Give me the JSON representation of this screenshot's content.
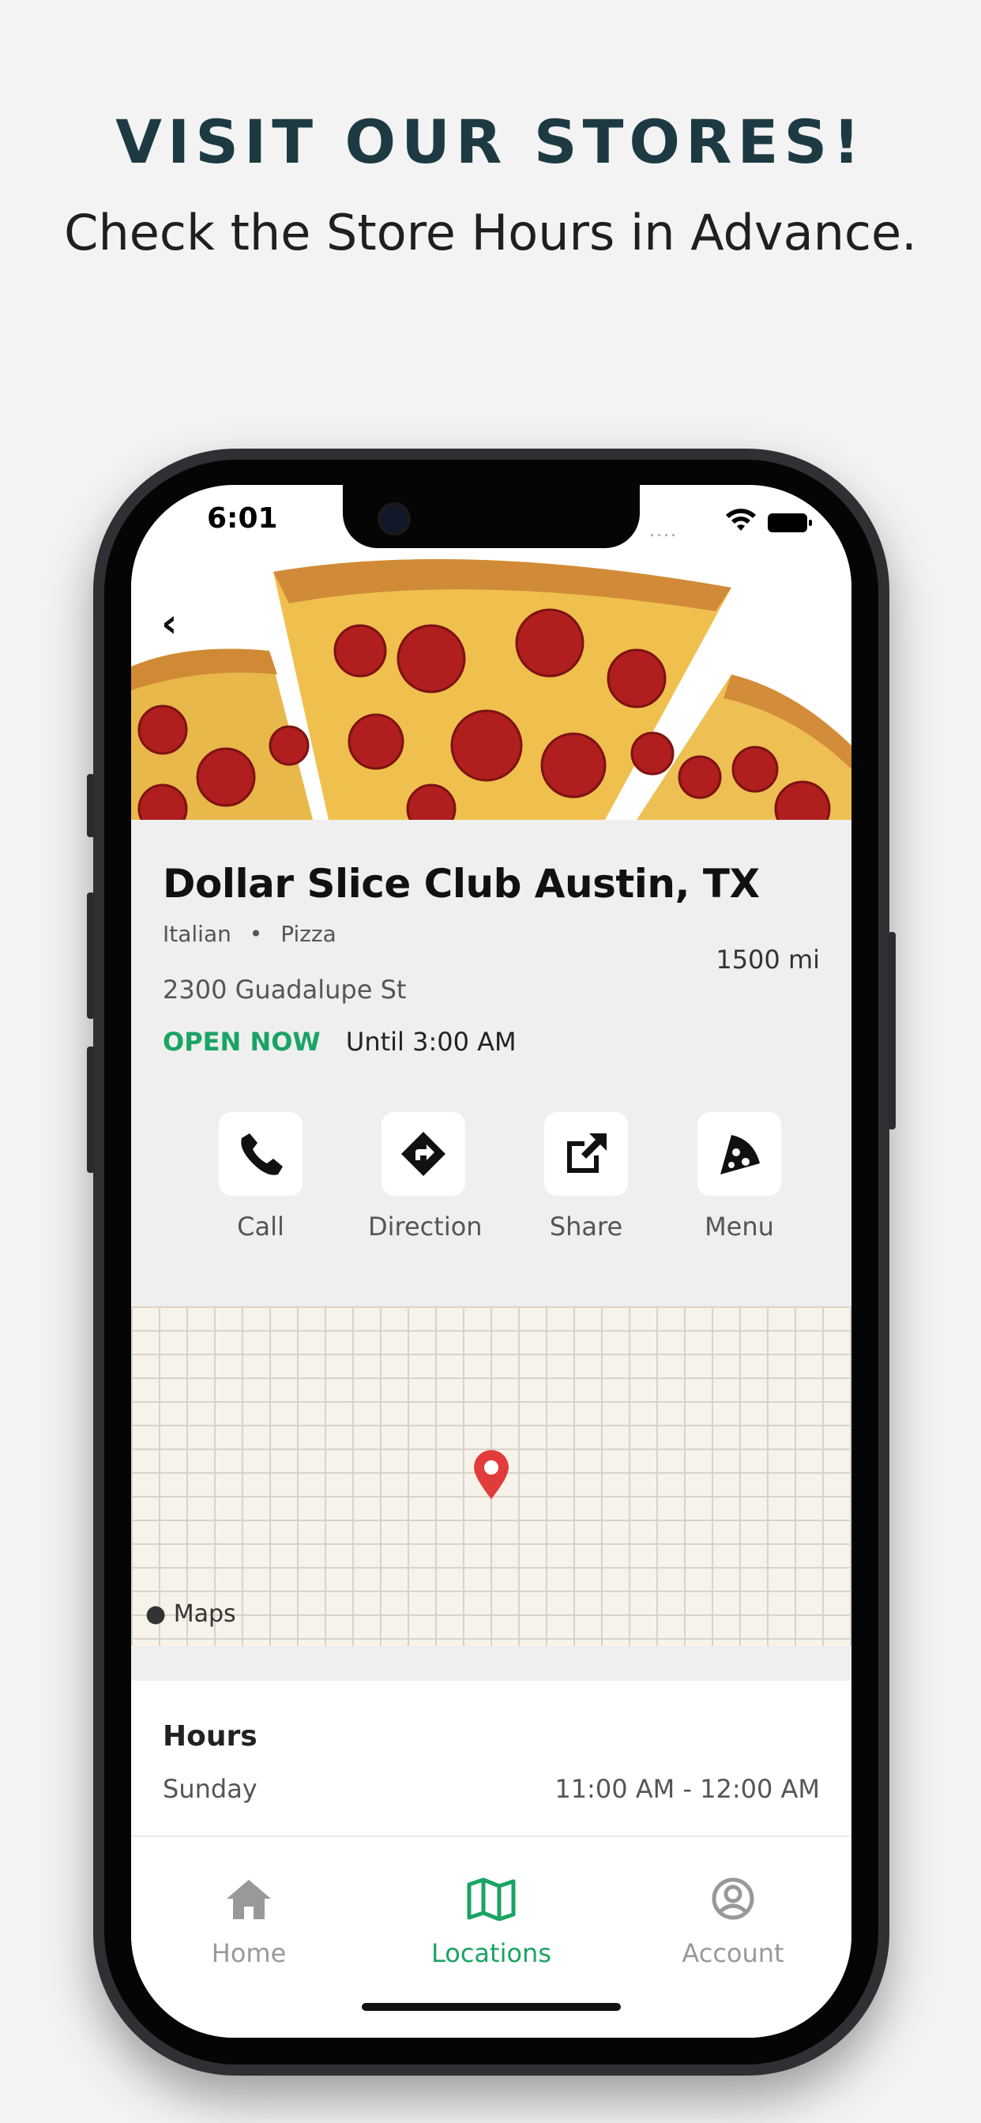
{
  "promo": {
    "headline": "VISIT OUR STORES!",
    "subline": "Check the Store Hours in Advance."
  },
  "status_bar": {
    "time": "6:01",
    "dots": "....",
    "icons": [
      "wifi-icon",
      "battery-icon"
    ]
  },
  "header": {
    "back_icon": "chevron-left-icon",
    "back_glyph": "‹",
    "hero_image": "pepperoni-pizza"
  },
  "store": {
    "name": "Dollar Slice Club Austin, TX",
    "cuisines": [
      "Italian",
      "Pizza"
    ],
    "separator": "•",
    "distance": "1500 mi",
    "address": "2300 Guadalupe St",
    "status": "OPEN NOW",
    "until": "Until 3:00 AM",
    "status_color": "#1aa463"
  },
  "actions": [
    {
      "label": "Call",
      "icon": "phone-icon"
    },
    {
      "label": "Direction",
      "icon": "direction-icon"
    },
    {
      "label": "Share",
      "icon": "share-icon"
    },
    {
      "label": "Menu",
      "icon": "pizza-slice-icon"
    }
  ],
  "map": {
    "attribution": "Maps",
    "pin_color": "#e23b3b"
  },
  "hours": {
    "title": "Hours",
    "rows": [
      {
        "day": "Sunday",
        "time": "11:00 AM - 12:00 AM"
      }
    ]
  },
  "tabbar": {
    "accent": "#1aa463",
    "tabs": [
      {
        "label": "Home",
        "icon": "home-icon",
        "active": false
      },
      {
        "label": "Locations",
        "icon": "map-icon",
        "active": true
      },
      {
        "label": "Account",
        "icon": "account-icon",
        "active": false
      }
    ]
  }
}
